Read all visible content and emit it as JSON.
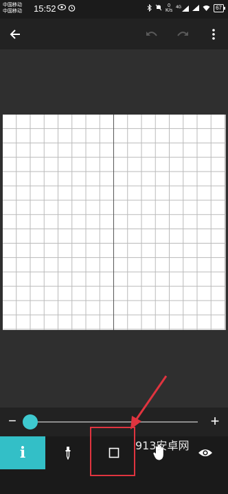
{
  "status_bar": {
    "carrier_1": "中国移动",
    "carrier_2": "中国移动",
    "time": "15:52",
    "speed_value": "0",
    "speed_unit": "K/s",
    "network": "4G",
    "battery": "67"
  },
  "app_bar": {
    "back_icon": "arrow-left-icon",
    "undo_icon": "undo-icon",
    "redo_icon": "redo-icon",
    "more_icon": "more-vertical-icon"
  },
  "zoom": {
    "minus_label": "−",
    "plus_label": "+",
    "level": 0.04
  },
  "toolbar": {
    "tools": [
      {
        "name": "info",
        "icon": "info-icon",
        "label": "i",
        "active": true
      },
      {
        "name": "dropper",
        "icon": "eyedropper-icon"
      },
      {
        "name": "square",
        "icon": "square-icon"
      },
      {
        "name": "pan",
        "icon": "hand-icon"
      },
      {
        "name": "view",
        "icon": "eye-icon"
      }
    ]
  },
  "watermark": "913安卓网",
  "colors": {
    "accent": "#33bfc7",
    "highlight": "#e0343f",
    "background": "#2f2f2f",
    "bar": "#222222"
  }
}
